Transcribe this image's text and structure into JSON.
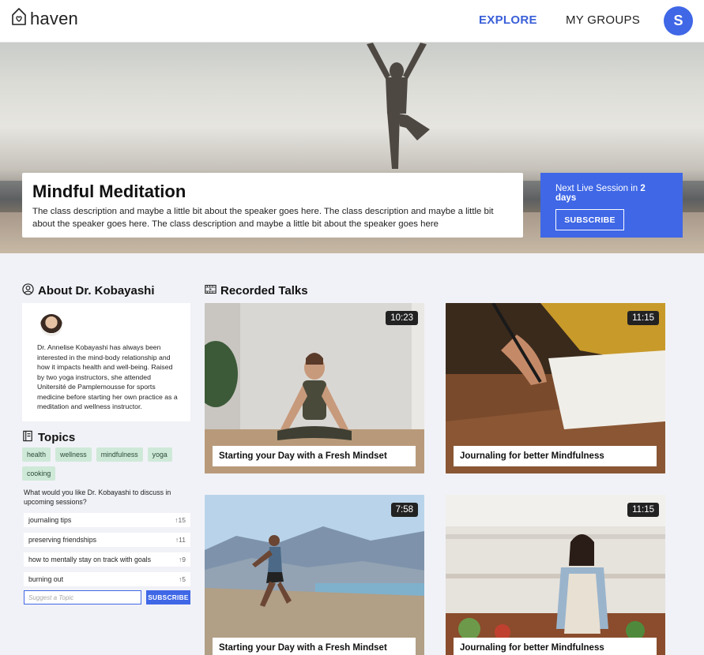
{
  "header": {
    "logo_text": "haven",
    "nav": {
      "explore": "EXPLORE",
      "my_groups": "MY GROUPS"
    },
    "avatar_initial": "S"
  },
  "hero": {
    "title": "Mindful Meditation",
    "description": "The class description and maybe a little bit about the speaker goes here. The class description and maybe a little bit about the speaker goes here. The class description and maybe a little bit about the speaker goes here",
    "live_prefix": "Next Live Session in ",
    "live_when": "2 days",
    "subscribe": "SUBSCRIBE"
  },
  "about": {
    "heading": "About Dr. Kobayashi",
    "bio": "Dr. Annelise Kobayashi has always been interested in the mind-body relationship and how it impacts health and well-being. Raised by two yoga instructors, she attended Unitersité de Pamplemousse for sports medicine before starting her own practice as a meditation and wellness instructor."
  },
  "topics": {
    "heading": "Topics",
    "tags": [
      "health",
      "wellness",
      "mindfulness",
      "yoga",
      "cooking"
    ],
    "ask": "What would you like Dr. Kobayashi to discuss in upcoming sessions?",
    "suggestions": [
      {
        "label": "journaling tips",
        "votes": "15"
      },
      {
        "label": "preserving friendships",
        "votes": "11"
      },
      {
        "label": "how to mentally stay on track with goals",
        "votes": "9"
      },
      {
        "label": "burning out",
        "votes": "5"
      }
    ],
    "input_placeholder": "Suggest a Topic",
    "subscribe": "SUBSCRIBE"
  },
  "recorded": {
    "heading": "Recorded Talks",
    "videos": [
      {
        "title": "Starting your Day with a Fresh Mindset",
        "duration": "10:23",
        "scene": "yoga"
      },
      {
        "title": "Journaling for better Mindfulness",
        "duration": "11:15",
        "scene": "journal"
      },
      {
        "title": "Starting your Day with a Fresh Mindset",
        "duration": "7:58",
        "scene": "run"
      },
      {
        "title": "Journaling for better Mindfulness",
        "duration": "11:15",
        "scene": "cook"
      }
    ]
  },
  "colors": {
    "accent": "#3f67e6",
    "tag_bg": "#cfe9d8",
    "page_bg": "#f1f2f7"
  }
}
